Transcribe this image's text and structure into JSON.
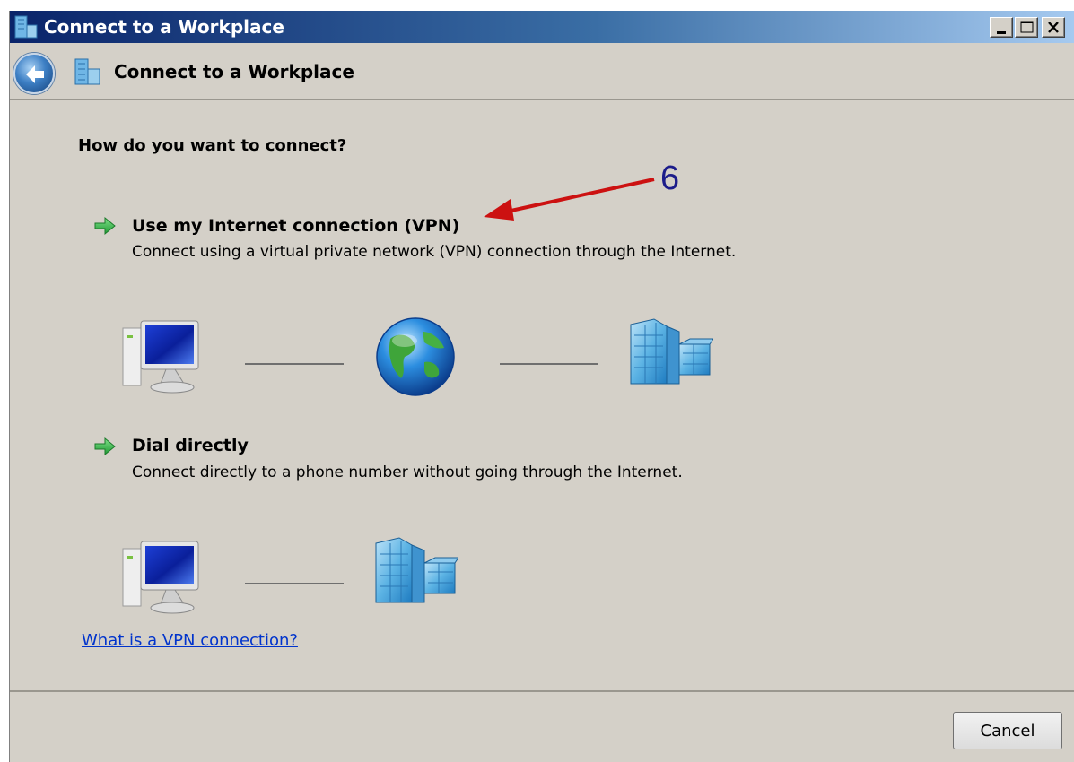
{
  "window": {
    "title": "Connect to a Workplace",
    "controls": [
      "minimize",
      "maximize",
      "close"
    ]
  },
  "header": {
    "title": "Connect to a Workplace"
  },
  "main": {
    "question": "How do you want to connect?",
    "options": [
      {
        "title": "Use my Internet connection (VPN)",
        "description": "Connect using a virtual private network (VPN) connection through the Internet.",
        "diagram": [
          "computer-icon",
          "globe-icon",
          "office-building-icon"
        ]
      },
      {
        "title": "Dial directly",
        "description": "Connect directly to a phone number without going through the Internet.",
        "diagram": [
          "computer-icon",
          "office-building-icon"
        ]
      }
    ],
    "annotation": {
      "number": "6",
      "color": "#cc1111"
    },
    "help_link": "What is a VPN connection?"
  },
  "footer": {
    "cancel_label": "Cancel"
  },
  "colors": {
    "titlebar_start": "#0a246a",
    "titlebar_end": "#a6caf0",
    "window_bg": "#d4d0c8",
    "link": "#0033cc",
    "option_arrow": "#2ea44f"
  }
}
